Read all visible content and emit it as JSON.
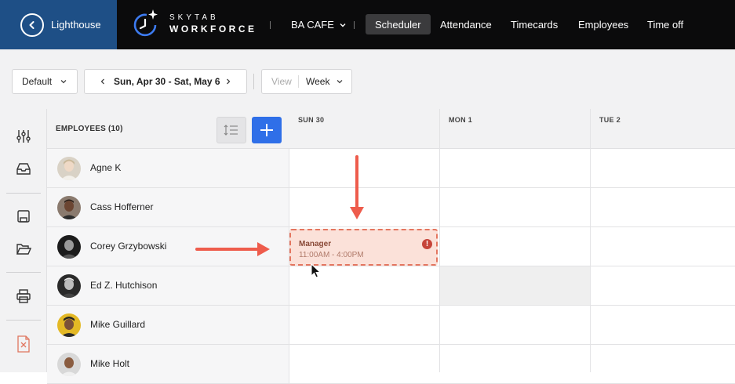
{
  "topbar": {
    "back_label": "Lighthouse",
    "logo_top": "SKYTAB",
    "logo_bottom": "WORKFORCE",
    "store_name": "BA CAFE",
    "nav": [
      "Scheduler",
      "Attendance",
      "Timecards",
      "Employees",
      "Time off"
    ],
    "active_nav": "Scheduler"
  },
  "toolbar": {
    "filter_value": "Default",
    "date_range": "Sun, Apr 30 - Sat, May 6",
    "view_label": "View",
    "view_value": "Week"
  },
  "grid": {
    "employees_header": "EMPLOYEES (10)",
    "days": [
      "SUN 30",
      "MON 1",
      "TUE 2"
    ],
    "employees": [
      {
        "name": "Agne K"
      },
      {
        "name": "Cass Hofferner"
      },
      {
        "name": "Corey Grzybowski"
      },
      {
        "name": "Ed Z. Hutchison"
      },
      {
        "name": "Mike Guillard"
      },
      {
        "name": "Mike Holt"
      }
    ]
  },
  "shift": {
    "role": "Manager",
    "time": "11:00AM - 4:00PM",
    "warning_icon": "exclamation-icon"
  },
  "colors": {
    "lighthouse_blue": "#1e4f86",
    "add_button_blue": "#2f6fe8",
    "shift_fill": "#fbe1d9",
    "shift_border": "#e47660",
    "annotation_arrow": "#ee5c4c"
  }
}
